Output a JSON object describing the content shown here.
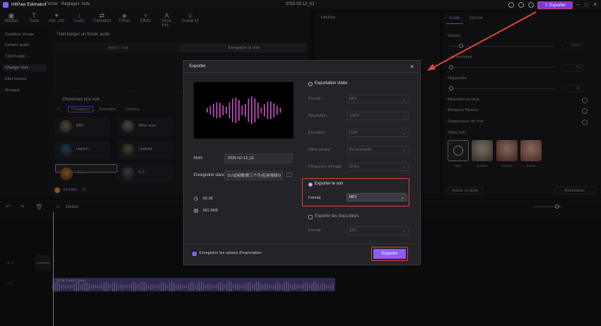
{
  "app": {
    "name": "HitPaw Edimakor",
    "menu": [
      "Fichier",
      "Reglages",
      "Aide"
    ],
    "doc_title": "2025-02-12_01",
    "export_label": "Exporter"
  },
  "toolbar": {
    "items": [
      {
        "label": "Médias",
        "icon": "media-icon"
      },
      {
        "label": "Texte",
        "icon": "text-icon"
      },
      {
        "label": "Aut...nts",
        "icon": "auto-icon"
      },
      {
        "label": "Audio",
        "icon": "music-icon"
      },
      {
        "label": "Transition",
        "icon": "transition-icon"
      },
      {
        "label": "Filtrer",
        "icon": "filter-icon"
      },
      {
        "label": "Effets",
        "icon": "effects-icon"
      },
      {
        "label": "Sous-tres...",
        "icon": "subtitle-icon"
      },
      {
        "label": "Avatar IA",
        "icon": "avatar-icon"
      }
    ],
    "active": "Audio"
  },
  "sidebar": {
    "items": [
      {
        "label": "Synthèse Vocale"
      },
      {
        "label": "Extraire audio"
      },
      {
        "label": "Télécharger ..."
      },
      {
        "label": "Changer Voix"
      },
      {
        "label": "Effet Sonore"
      },
      {
        "label": "Musique"
      }
    ],
    "active": "Changer Voix"
  },
  "audio_panel": {
    "upload_title": "Téléchargez un fichier audio",
    "tabs": [
      "Audio Local",
      "Enregistrer la Voix"
    ],
    "voices_title": "Choisissez une voix",
    "categories": [
      "Populaires",
      "Animation",
      "Cinéma"
    ],
    "voices": [
      "BBC",
      "Wise man",
      "Hacker",
      "Undead",
      "Queen",
      "E.T"
    ],
    "credits": "29/4640"
  },
  "preview": {
    "title": "Lecture"
  },
  "right_panel": {
    "tabs": [
      "Audio",
      "Vitesse"
    ],
    "volume_label": "Volume",
    "volume_value": "100%",
    "fade_in_label": "...du enchaîné",
    "fade_in_value": "0s",
    "fade_out_label": "Disparaître",
    "fade_out_value": "0s",
    "noise_label": "Réduction du bruit",
    "beat_label": "Marqueur Mesure",
    "vocal_label": "Suppresseur de Voix",
    "effects_label": "Effets Voix",
    "effects": [
      "Rien",
      "Homme",
      "Femme",
      "Enfant"
    ],
    "apply_all": "Paiele en texte",
    "reset": "Réinitialiser"
  },
  "timeline": {
    "split_label": "Diviser",
    "track_label": "couverture",
    "clip_label": "00:38 Tracks: Queen"
  },
  "dialog": {
    "title": "Exporter",
    "name_label": "Nom",
    "name_value": "2025-02-12_01",
    "save_label": "Enregistrer dans",
    "save_value": "D:/试用期/第三个月/应用视频/3",
    "duration": "00:38",
    "size": "601.6KB",
    "video_section": "Exportation vidéo",
    "video_fields": [
      {
        "label": "Format",
        "value": "MP4"
      },
      {
        "label": "Résolution",
        "value": "1080P"
      },
      {
        "label": "Encodeur",
        "value": "H264"
      },
      {
        "label": "Débit binaire",
        "value": "Recommandé"
      },
      {
        "label": "Fréquence d'image",
        "value": "30 fps"
      }
    ],
    "sound_section": "Exporter le son",
    "sound_format_label": "Format",
    "sound_format_value": "MP3",
    "subtitle_section": "Exporter les Sous-titres",
    "subtitle_format_label": "Format",
    "subtitle_format_value": "SRT",
    "save_options": "Enregistrer les options d'exportation",
    "export_button": "Exporter"
  },
  "colors": {
    "accent": "#8b5cf6",
    "highlight": "#e0453a",
    "background": "#151518"
  }
}
